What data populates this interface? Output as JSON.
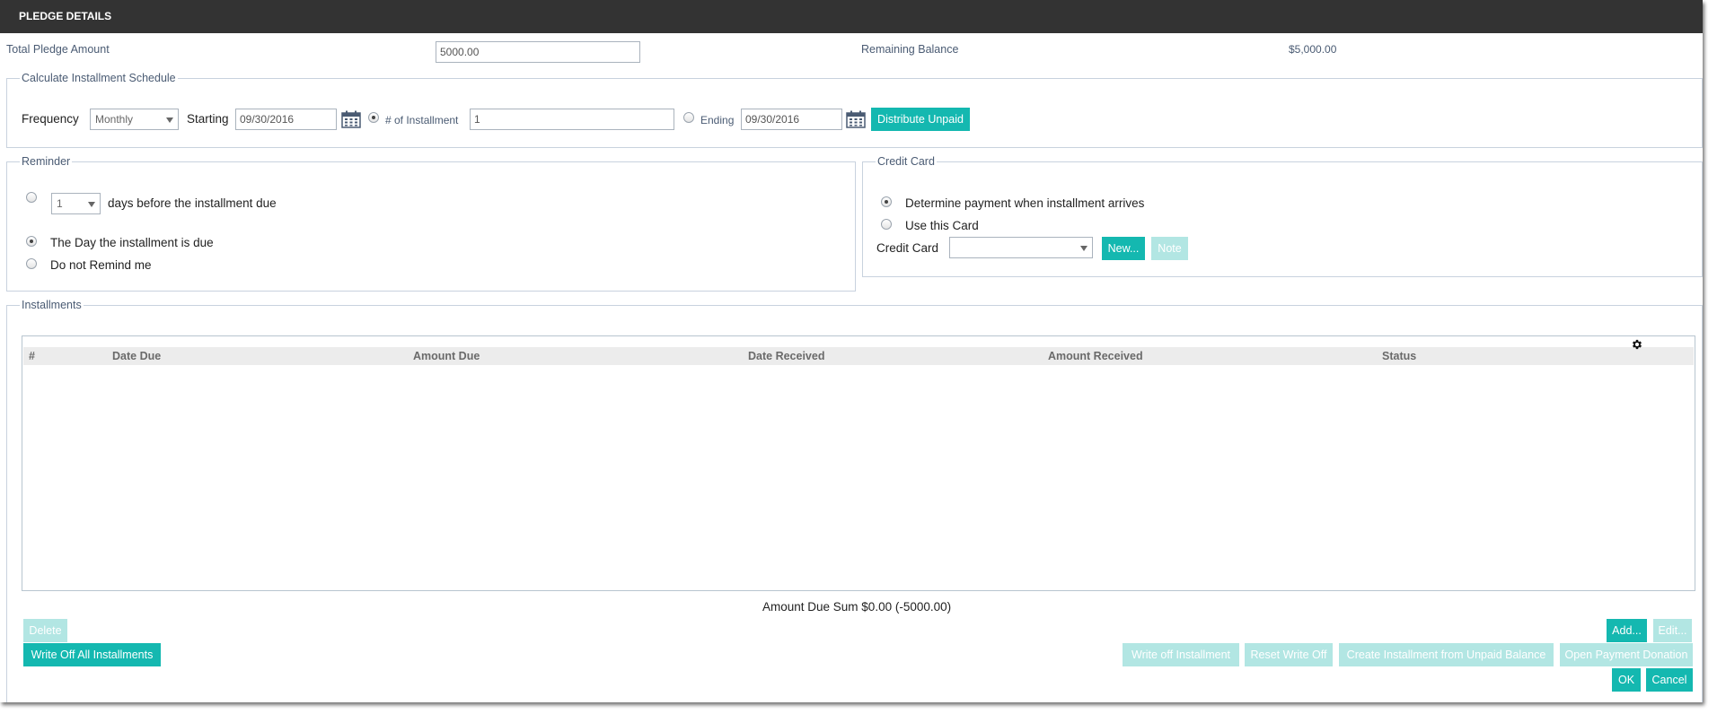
{
  "title": "PLEDGE DETAILS",
  "pledge": {
    "total_label": "Total Pledge Amount",
    "total_value": "5000.00",
    "remaining_label": "Remaining Balance",
    "remaining_value": "$5,000.00"
  },
  "schedule": {
    "legend": "Calculate Installment Schedule",
    "frequency_label": "Frequency",
    "frequency_value": "Monthly",
    "starting_label": "Starting",
    "starting_value": "09/30/2016",
    "installments_label": "# of Installment",
    "installments_value": "1",
    "ending_label": "Ending",
    "ending_value": "09/30/2016",
    "distribute_label": "Distribute Unpaid"
  },
  "reminder": {
    "legend": "Reminder",
    "days_value": "1",
    "days_label": "days before the installment due",
    "day_due_label": "The Day the installment is due",
    "no_remind_label": "Do not Remind me"
  },
  "credit_card": {
    "legend": "Credit Card",
    "determine_label": "Determine payment when installment arrives",
    "use_card_label": "Use this Card",
    "card_label": "Credit Card",
    "card_value": "",
    "new_label": "New...",
    "note_label": "Note"
  },
  "installments": {
    "legend": "Installments",
    "columns": [
      "#",
      "Date Due",
      "Amount Due",
      "Date Received",
      "Amount Received",
      "Status"
    ],
    "rows": [],
    "sum_text": "Amount Due Sum $0.00 (-5000.00)"
  },
  "actions": {
    "delete": "Delete",
    "write_off_all": "Write Off All Installments",
    "add": "Add...",
    "edit": "Edit...",
    "write_off": "Write off Installment",
    "reset_write_off": "Reset Write Off",
    "create_from_unpaid": "Create Installment from Unpaid Balance",
    "open_payment": "Open Payment Donation",
    "ok": "OK",
    "cancel": "Cancel"
  },
  "colors": {
    "titlebar": "#333333",
    "accent": "#14b8b0",
    "accent_disabled": "#b2e6e3"
  },
  "icons": [
    "calendar-icon",
    "gear-icon",
    "chevron-down-icon"
  ]
}
